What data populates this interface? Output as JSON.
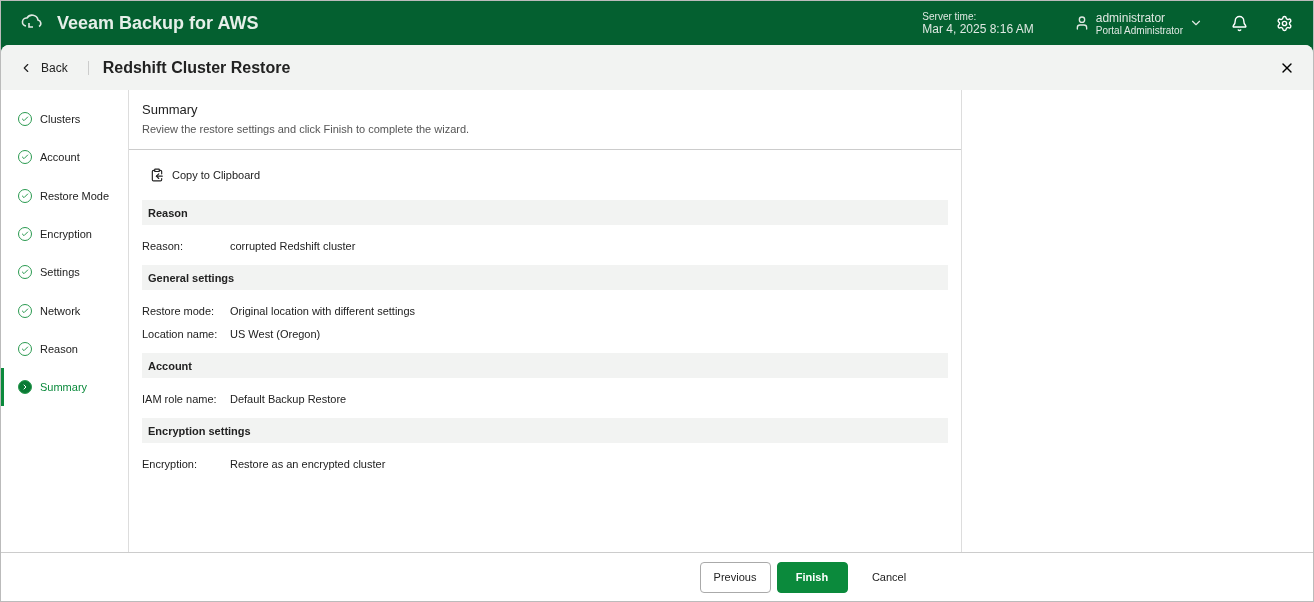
{
  "app": {
    "title": "Veeam Backup for AWS",
    "server_time_label": "Server time:",
    "server_time": "Mar 4, 2025 8:16 AM",
    "user": {
      "name": "administrator",
      "role": "Portal Administrator"
    }
  },
  "wizard": {
    "back": "Back",
    "title": "Redshift Cluster Restore"
  },
  "steps": [
    {
      "label": "Clusters",
      "selected": false
    },
    {
      "label": "Account",
      "selected": false
    },
    {
      "label": "Restore Mode",
      "selected": false
    },
    {
      "label": "Encryption",
      "selected": false
    },
    {
      "label": "Settings",
      "selected": false
    },
    {
      "label": "Network",
      "selected": false
    },
    {
      "label": "Reason",
      "selected": false
    },
    {
      "label": "Summary",
      "selected": true
    }
  ],
  "page": {
    "title": "Summary",
    "description": "Review the restore settings and click Finish to complete the wizard.",
    "copy": "Copy to Clipboard"
  },
  "sections": [
    {
      "title": "Reason",
      "rows": [
        {
          "label": "Reason:",
          "value": "corrupted Redshift cluster"
        }
      ]
    },
    {
      "title": "General settings",
      "rows": [
        {
          "label": "Restore mode:",
          "value": "Original location with different settings"
        },
        {
          "label": "Location name:",
          "value": "US West (Oregon)"
        }
      ]
    },
    {
      "title": "Account",
      "rows": [
        {
          "label": "IAM role name:",
          "value": "Default Backup Restore"
        }
      ]
    },
    {
      "title": "Encryption settings",
      "rows": [
        {
          "label": "Encryption:",
          "value": "Restore as an encrypted cluster"
        }
      ]
    }
  ],
  "buttons": [
    {
      "label": "Previous",
      "kind": "outline"
    },
    {
      "label": "Finish",
      "kind": "primary"
    },
    {
      "label": "Cancel",
      "kind": "plain"
    }
  ]
}
